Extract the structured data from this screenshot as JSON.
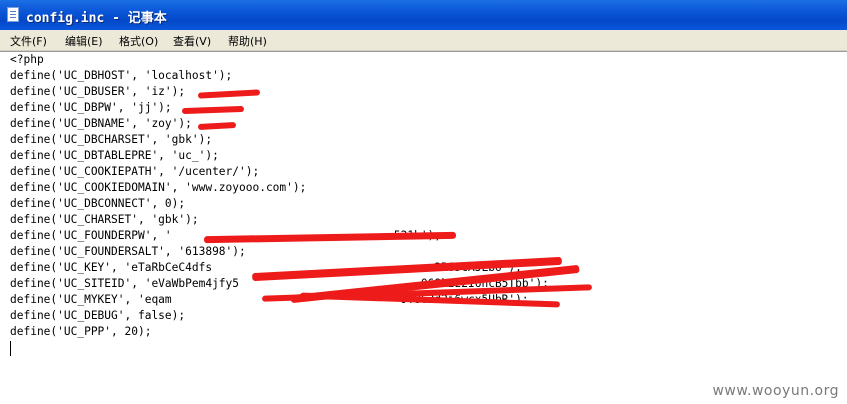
{
  "window": {
    "title": "config.inc - 记事本",
    "app_icon": "notepad-icon"
  },
  "menu": [
    {
      "label": "文件(F)"
    },
    {
      "label": "编辑(E)"
    },
    {
      "label": "格式(O)"
    },
    {
      "label": "查看(V)"
    },
    {
      "label": "帮助(H)"
    }
  ],
  "editor": {
    "lines": [
      "<?php",
      "define('UC_DBHOST', 'localhost');",
      "define('UC_DBUSER', 'iz');",
      "define('UC_DBPW', 'jj');",
      "define('UC_DBNAME', 'zoy');",
      "define('UC_DBCHARSET', 'gbk');",
      "define('UC_DBTABLEPRE', 'uc_');",
      "define('UC_COOKIEPATH', '/ucenter/');",
      "define('UC_COOKIEDOMAIN', 'www.zoyooo.com');",
      "define('UC_DBCONNECT', 0);",
      "define('UC_CHARSET', 'gbk');",
      "define('UC_FOUNDERPW', '                                 521b');",
      "define('UC_FOUNDERSALT', '613898');",
      "define('UC_KEY', 'eTaRbCeC4dfs                                e2R6JcA5Lbo');",
      "define('UC_SITEID', 'eVaWbPem4jfy5                           068k2z2I6ncB5Tbb');",
      "define('UC_MYKEY', 'eqam                                  9Y862d2i6wcx5UbR');",
      "define('UC_DEBUG', false);",
      "define('UC_PPP', 20);"
    ]
  },
  "watermark": "www.wooyun.org",
  "colors": {
    "titlebar": "#0a55d8",
    "menubar": "#ece9d8",
    "redaction": "#ee1b1b"
  }
}
